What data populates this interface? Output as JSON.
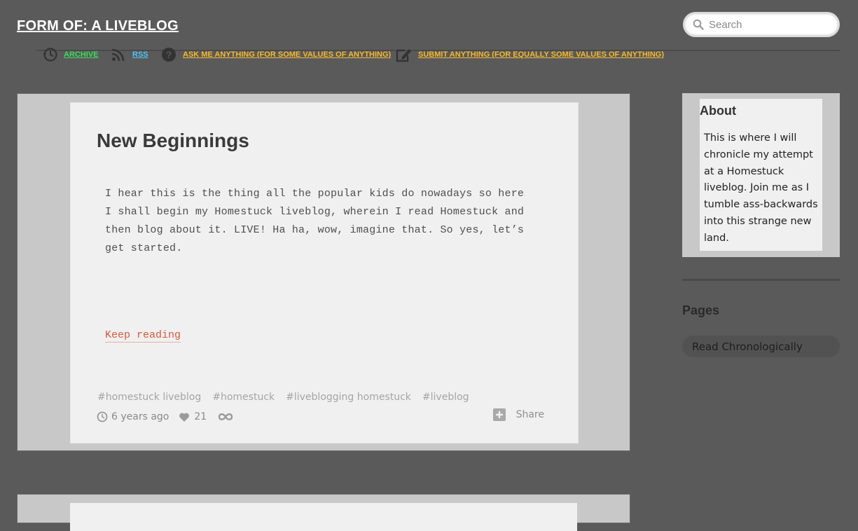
{
  "header": {
    "blog_title": "FORM OF: A LIVEBLOG",
    "search_placeholder": "Search"
  },
  "nav": {
    "items": [
      {
        "label": "ARCHIVE",
        "icon": "clock-icon",
        "color": "#3ddc5a"
      },
      {
        "label": "RSS",
        "icon": "rss-icon",
        "color": "#4fc3f7"
      },
      {
        "label": "ASK ME ANYTHING (FOR SOME VALUES OF ANYTHING)",
        "icon": "question-icon",
        "color": "#f5b82e"
      },
      {
        "label": "SUBMIT ANYTHING (FOR EQUALLY SOME VALUES OF ANYTHING)",
        "icon": "edit-icon",
        "color": "#f5b82e"
      }
    ]
  },
  "post": {
    "title": "New Beginnings",
    "body": "I hear this is the thing all the popular kids do nowadays so here I shall begin my Homestuck liveblog, wherein I read Homestuck and then blog about it. LIVE! Ha ha, wow, imagine that. So yes, let’s get started.",
    "keep_reading": "Keep reading",
    "tags": [
      "#homestuck liveblog",
      "#homestuck",
      "#liveblogging homestuck",
      "#liveblog"
    ],
    "timestamp": "6 years ago",
    "likes": "21",
    "share_label": "Share"
  },
  "sidebar": {
    "about_title": "About",
    "about_text": "This is where I will chronicle my attempt at a Homestuck liveblog. Join me as I tumble ass-backwards into this strange new land.",
    "pages_title": "Pages",
    "pages_links": [
      "Read Chronologically"
    ]
  },
  "colors": {
    "background": "#5a5a5a",
    "link_accent": "#d9583b"
  }
}
